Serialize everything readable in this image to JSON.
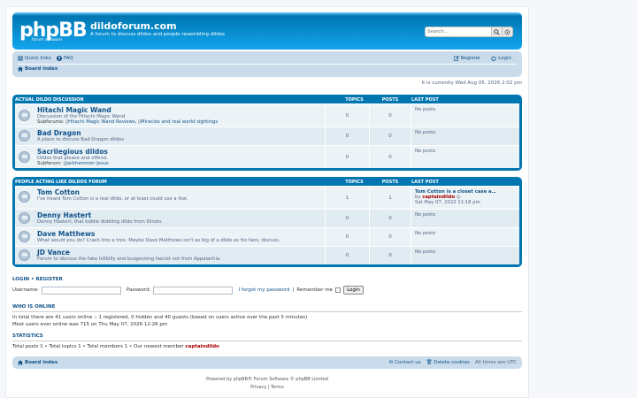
{
  "header": {
    "logo_main": "phpBB",
    "logo_sub": "forum software",
    "site_title": "dildoforum.com",
    "site_desc": "A forum to discuss dildos and people resembling dildos",
    "search_placeholder": "Search…"
  },
  "nav": {
    "quick_links": "Quick links",
    "faq": "FAQ",
    "register": "Register",
    "login": "Login",
    "board_index": "Board index"
  },
  "current_time": "It is currently Wed Aug 05, 2026 2:02 pm",
  "columns": {
    "topics": "TOPICS",
    "posts": "POSTS",
    "last_post": "LAST POST"
  },
  "categories": [
    {
      "title": "ACTUAL DILDO DISCUSSION",
      "forums": [
        {
          "name": "Hitachi Magic Wand",
          "desc": "Discussion of the Hitachi Magic Wand",
          "sub_label": "Subforums:",
          "subs": [
            "Hitachi Magic Wand Reviews,",
            "Miracles and real world sightings"
          ],
          "topics": "0",
          "posts": "0",
          "last": "No posts"
        },
        {
          "name": "Bad Dragon",
          "desc": "A place to discuss Bad Dragon dildos",
          "topics": "0",
          "posts": "0",
          "last": "No posts"
        },
        {
          "name": "Sacrilegious dildos",
          "desc": "Dildos that please and offend.",
          "sub_label": "Subforum:",
          "subs": [
            "Jackhammer Jesus"
          ],
          "topics": "0",
          "posts": "0",
          "last": "No posts"
        }
      ]
    },
    {
      "title": "PEOPLE ACTING LIKE DILDOS FORUM",
      "forums": [
        {
          "name": "Tom Cotton",
          "desc": "I've heard Tom Cotton is a real dildo, or at least could use a few.",
          "topics": "1",
          "posts": "1",
          "last_title": "Tom Cotton is a closet case a…",
          "last_by": "by",
          "last_author": "captaindildo",
          "last_date": "Sat May 07, 2022 11:18 pm"
        },
        {
          "name": "Denny Hastert",
          "desc": "Denny Hastert, that kiddie diddling dildo from Illinois.",
          "topics": "0",
          "posts": "0",
          "last": "No posts"
        },
        {
          "name": "Dave Matthews",
          "desc": "What would you do? Crash into a tree. Maybe Dave Matthews isn't as big of a dildo as his fans, discuss.",
          "topics": "0",
          "posts": "0",
          "last": "No posts"
        },
        {
          "name": "JD Vance",
          "desc": "Forum to discuss the fake hillbilly and burgeoning fascist not from Appalachia.",
          "topics": "0",
          "posts": "0",
          "last": "No posts"
        }
      ]
    }
  ],
  "login": {
    "heading_login": "LOGIN",
    "heading_register": "REGISTER",
    "username": "Username:",
    "password": "Password:",
    "forgot": "I forgot my password",
    "remember": "Remember me",
    "button": "Login"
  },
  "who": {
    "heading": "WHO IS ONLINE",
    "line1": "In total there are 41 users online :: 1 registered, 0 hidden and 40 guests (based on users active over the past 5 minutes)",
    "line2": "Most users ever online was 715 on Thu May 07, 2026 12:26 pm"
  },
  "stats": {
    "heading": "STATISTICS",
    "line": "Total posts 1 • Total topics 1 • Total members 1 • Our newest member",
    "newest": "captaindildo"
  },
  "footer": {
    "board_index": "Board index",
    "contact": "Contact us",
    "cookies": "Delete cookies",
    "tz": "All times are UTC",
    "powered": "Powered by phpBB® Forum Software © phpBB Limited",
    "links": "Privacy | Terms"
  }
}
